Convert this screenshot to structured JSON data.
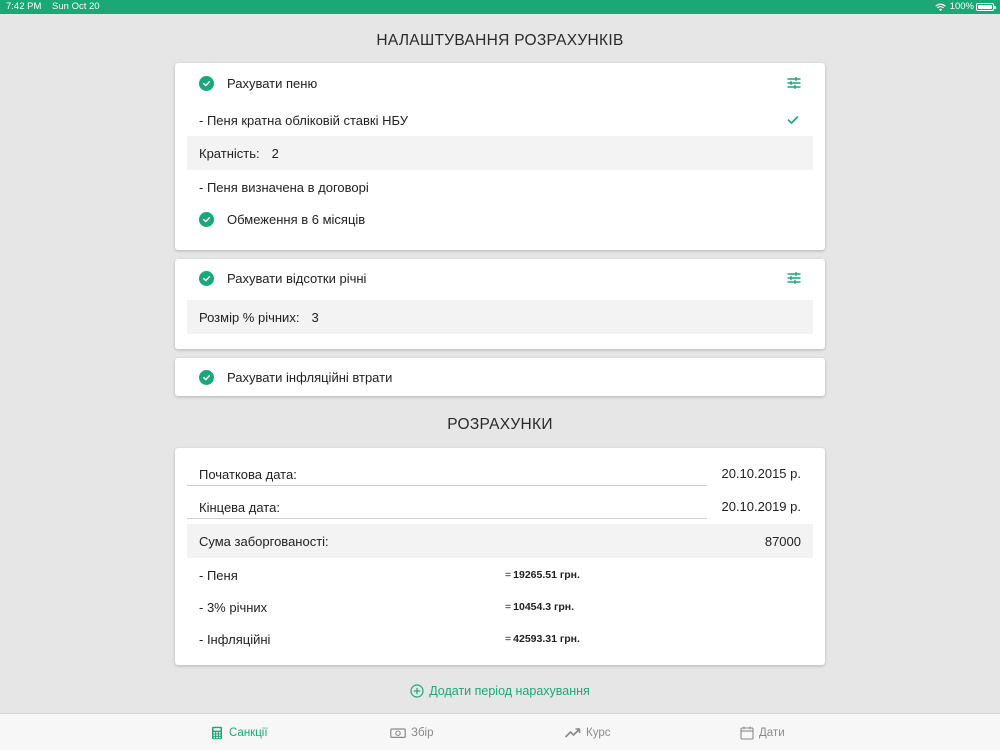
{
  "status_bar": {
    "time": "7:42 PM",
    "date": "Sun Oct 20",
    "battery": "100%"
  },
  "settings": {
    "title": "НАЛАШТУВАННЯ РОЗРАХУНКІВ",
    "penalty_card": {
      "main_label": "Рахувати пеню",
      "nbu_option": "- Пеня кратна обліковій ставкі НБУ",
      "multiplicity_label": "Кратність:",
      "multiplicity_value": "2",
      "contract_option": "- Пеня визначена в договорі",
      "limit_label": "Обмеження в 6 місяців"
    },
    "interest_card": {
      "main_label": "Рахувати відсотки річні",
      "rate_label": "Розмір % річних:",
      "rate_value": "3"
    },
    "inflation_card": {
      "main_label": "Рахувати інфляційні втрати"
    }
  },
  "calculations": {
    "title": "РОЗРАХУНКИ",
    "start_date_label": "Початкова дата:",
    "start_date_value": "20.10.2015 р.",
    "end_date_label": "Кінцева дата:",
    "end_date_value": "20.10.2019 р.",
    "debt_label": "Сума заборгованості:",
    "debt_value": "87000",
    "results": [
      {
        "label": "- Пеня",
        "eq": "=",
        "amount": "19265.51 грн."
      },
      {
        "label": "- 3% річних",
        "eq": "=",
        "amount": "10454.3 грн."
      },
      {
        "label": "- Інфляційні",
        "eq": "=",
        "amount": "42593.31 грн."
      }
    ]
  },
  "add_period_label": "Додати період нарахування",
  "tabs": [
    {
      "label": "Санкції",
      "icon": "calculator-icon"
    },
    {
      "label": "Збір",
      "icon": "cash-icon"
    },
    {
      "label": "Курс",
      "icon": "trending-up-icon"
    },
    {
      "label": "Дати",
      "icon": "calendar-icon"
    }
  ],
  "colors": {
    "accent": "#1aa877",
    "status_bar": "#1aa877",
    "background": "#e6e6e6",
    "inactive_tab": "#8a8a8a"
  }
}
